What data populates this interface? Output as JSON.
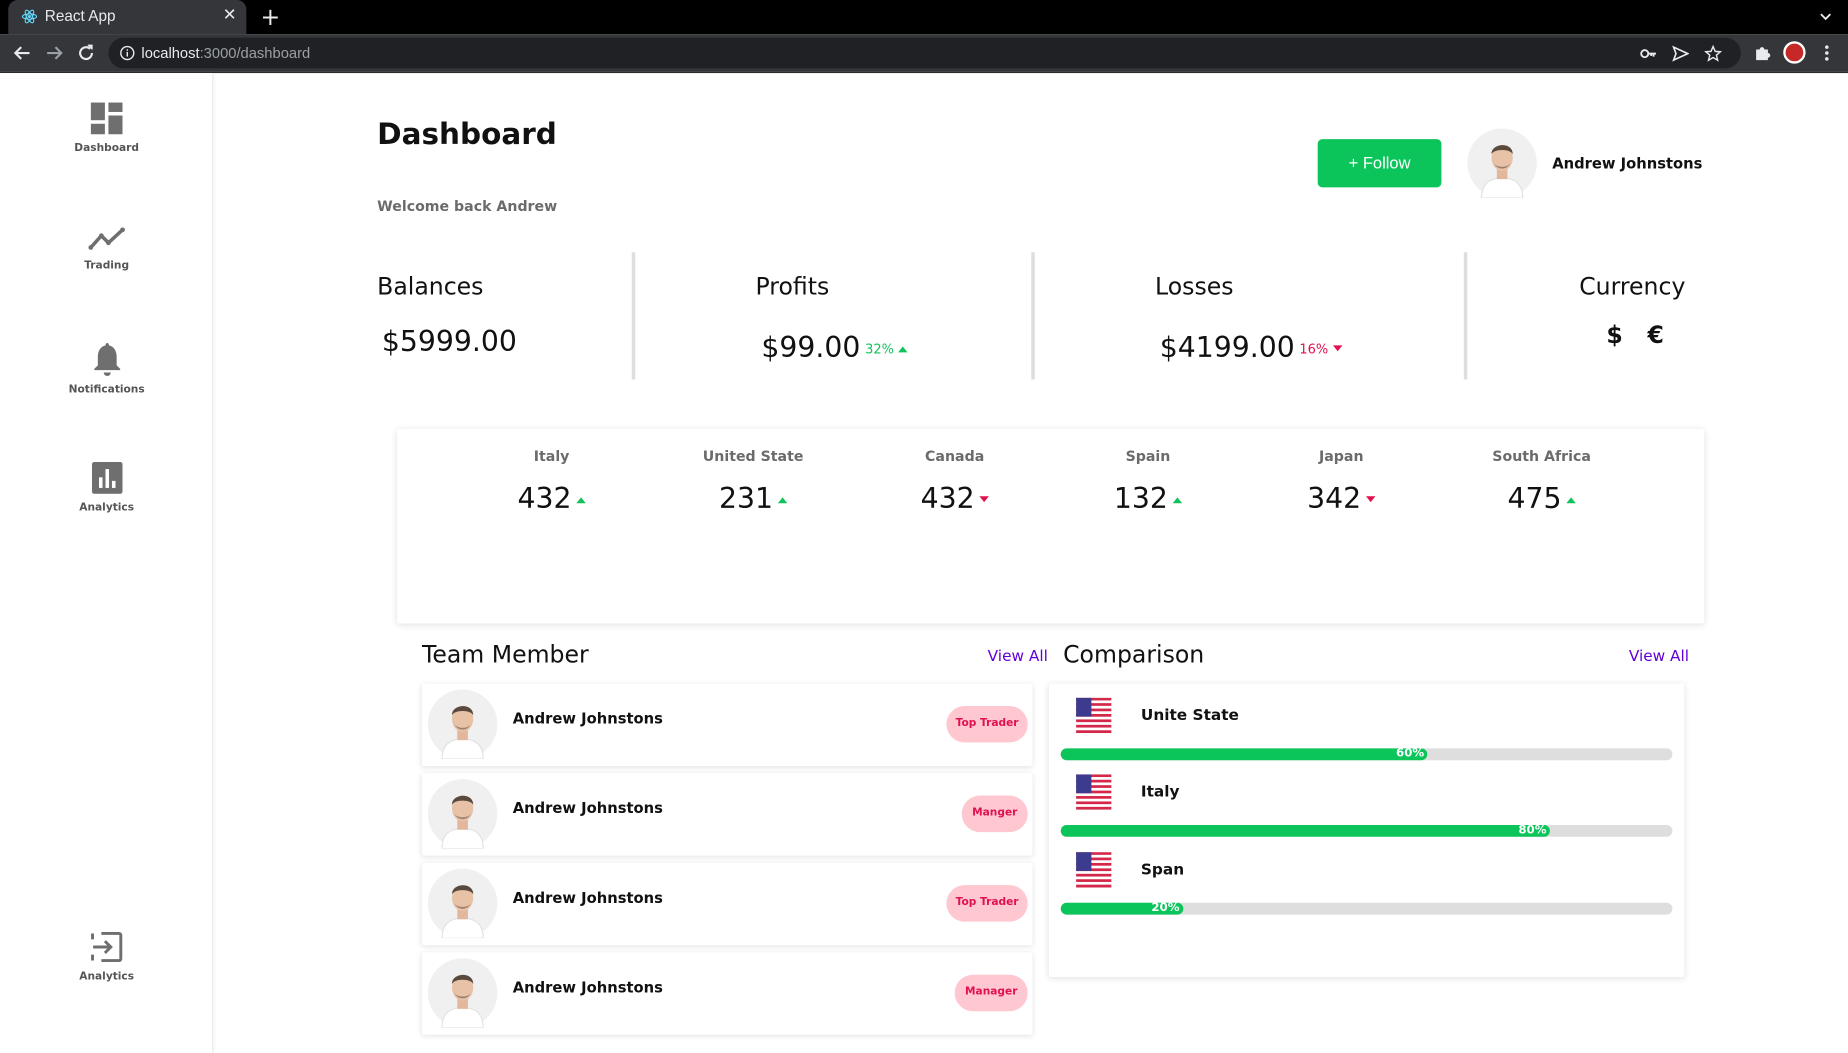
{
  "browser": {
    "tab_title": "React App",
    "url_host": "localhost",
    "url_path": ":3000/dashboard"
  },
  "sidebar": {
    "items": [
      {
        "label": "Dashboard",
        "icon": "dashboard-icon"
      },
      {
        "label": "Trading",
        "icon": "trending-icon"
      },
      {
        "label": "Notifications",
        "icon": "bell-icon"
      },
      {
        "label": "Analytics",
        "icon": "bar-chart-icon"
      }
    ],
    "footer_item": {
      "label": "Analytics",
      "icon": "exit-icon"
    }
  },
  "header": {
    "title": "Dashboard",
    "welcome": "Welcome back Andrew",
    "follow_label": "+ Follow",
    "user_name": "Andrew Johnstons"
  },
  "stats": {
    "balances": {
      "label": "Balances",
      "value": "$5999.00"
    },
    "profits": {
      "label": "Profits",
      "value": "$99.00",
      "change": "32%",
      "trend": "up"
    },
    "losses": {
      "label": "Losses",
      "value": "$4199.00",
      "change": "16%",
      "trend": "down"
    },
    "currency": {
      "label": "Currency",
      "symbols": "$ €"
    }
  },
  "countries": [
    {
      "name": "Italy",
      "value": "432",
      "trend": "up"
    },
    {
      "name": "United State",
      "value": "231",
      "trend": "up"
    },
    {
      "name": "Canada",
      "value": "432",
      "trend": "down"
    },
    {
      "name": "Spain",
      "value": "132",
      "trend": "up"
    },
    {
      "name": "Japan",
      "value": "342",
      "trend": "down"
    },
    {
      "name": "South Africa",
      "value": "475",
      "trend": "up"
    }
  ],
  "team": {
    "title": "Team Member",
    "view_all": "View All",
    "members": [
      {
        "name": "Andrew Johnstons",
        "role": "Top Trader"
      },
      {
        "name": "Andrew Johnstons",
        "role": "Manger"
      },
      {
        "name": "Andrew Johnstons",
        "role": "Top Trader"
      },
      {
        "name": "Andrew Johnstons",
        "role": "Manager"
      }
    ]
  },
  "comparison": {
    "title": "Comparison",
    "view_all": "View All",
    "items": [
      {
        "name": "Unite State",
        "percent": "60%",
        "fraction": 0.6
      },
      {
        "name": "Italy",
        "percent": "80%",
        "fraction": 0.8
      },
      {
        "name": "Span",
        "percent": "20%",
        "fraction": 0.2
      }
    ]
  },
  "colors": {
    "accent_green": "#0cc55a",
    "down_red": "#e0114e",
    "badge_pink": "#ffc7d0",
    "link_purple": "#6200d9"
  }
}
